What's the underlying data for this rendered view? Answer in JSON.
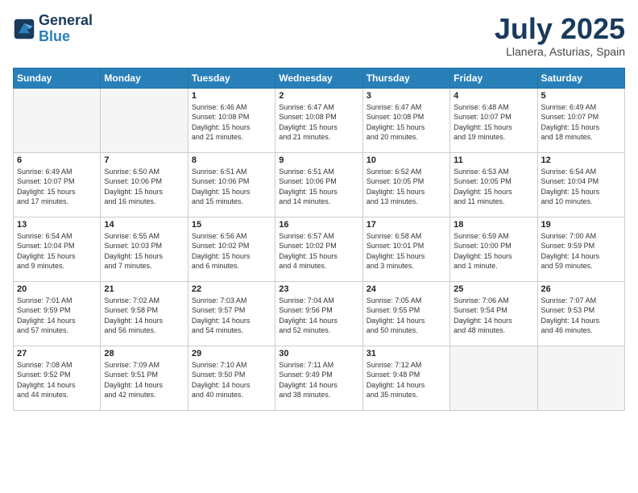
{
  "header": {
    "logo_line1": "General",
    "logo_line2": "Blue",
    "month_title": "July 2025",
    "location": "Llanera, Asturias, Spain"
  },
  "weekdays": [
    "Sunday",
    "Monday",
    "Tuesday",
    "Wednesday",
    "Thursday",
    "Friday",
    "Saturday"
  ],
  "weeks": [
    [
      {
        "day": "",
        "info": ""
      },
      {
        "day": "",
        "info": ""
      },
      {
        "day": "1",
        "info": "Sunrise: 6:46 AM\nSunset: 10:08 PM\nDaylight: 15 hours\nand 21 minutes."
      },
      {
        "day": "2",
        "info": "Sunrise: 6:47 AM\nSunset: 10:08 PM\nDaylight: 15 hours\nand 21 minutes."
      },
      {
        "day": "3",
        "info": "Sunrise: 6:47 AM\nSunset: 10:08 PM\nDaylight: 15 hours\nand 20 minutes."
      },
      {
        "day": "4",
        "info": "Sunrise: 6:48 AM\nSunset: 10:07 PM\nDaylight: 15 hours\nand 19 minutes."
      },
      {
        "day": "5",
        "info": "Sunrise: 6:49 AM\nSunset: 10:07 PM\nDaylight: 15 hours\nand 18 minutes."
      }
    ],
    [
      {
        "day": "6",
        "info": "Sunrise: 6:49 AM\nSunset: 10:07 PM\nDaylight: 15 hours\nand 17 minutes."
      },
      {
        "day": "7",
        "info": "Sunrise: 6:50 AM\nSunset: 10:06 PM\nDaylight: 15 hours\nand 16 minutes."
      },
      {
        "day": "8",
        "info": "Sunrise: 6:51 AM\nSunset: 10:06 PM\nDaylight: 15 hours\nand 15 minutes."
      },
      {
        "day": "9",
        "info": "Sunrise: 6:51 AM\nSunset: 10:06 PM\nDaylight: 15 hours\nand 14 minutes."
      },
      {
        "day": "10",
        "info": "Sunrise: 6:52 AM\nSunset: 10:05 PM\nDaylight: 15 hours\nand 13 minutes."
      },
      {
        "day": "11",
        "info": "Sunrise: 6:53 AM\nSunset: 10:05 PM\nDaylight: 15 hours\nand 11 minutes."
      },
      {
        "day": "12",
        "info": "Sunrise: 6:54 AM\nSunset: 10:04 PM\nDaylight: 15 hours\nand 10 minutes."
      }
    ],
    [
      {
        "day": "13",
        "info": "Sunrise: 6:54 AM\nSunset: 10:04 PM\nDaylight: 15 hours\nand 9 minutes."
      },
      {
        "day": "14",
        "info": "Sunrise: 6:55 AM\nSunset: 10:03 PM\nDaylight: 15 hours\nand 7 minutes."
      },
      {
        "day": "15",
        "info": "Sunrise: 6:56 AM\nSunset: 10:02 PM\nDaylight: 15 hours\nand 6 minutes."
      },
      {
        "day": "16",
        "info": "Sunrise: 6:57 AM\nSunset: 10:02 PM\nDaylight: 15 hours\nand 4 minutes."
      },
      {
        "day": "17",
        "info": "Sunrise: 6:58 AM\nSunset: 10:01 PM\nDaylight: 15 hours\nand 3 minutes."
      },
      {
        "day": "18",
        "info": "Sunrise: 6:59 AM\nSunset: 10:00 PM\nDaylight: 15 hours\nand 1 minute."
      },
      {
        "day": "19",
        "info": "Sunrise: 7:00 AM\nSunset: 9:59 PM\nDaylight: 14 hours\nand 59 minutes."
      }
    ],
    [
      {
        "day": "20",
        "info": "Sunrise: 7:01 AM\nSunset: 9:59 PM\nDaylight: 14 hours\nand 57 minutes."
      },
      {
        "day": "21",
        "info": "Sunrise: 7:02 AM\nSunset: 9:58 PM\nDaylight: 14 hours\nand 56 minutes."
      },
      {
        "day": "22",
        "info": "Sunrise: 7:03 AM\nSunset: 9:57 PM\nDaylight: 14 hours\nand 54 minutes."
      },
      {
        "day": "23",
        "info": "Sunrise: 7:04 AM\nSunset: 9:56 PM\nDaylight: 14 hours\nand 52 minutes."
      },
      {
        "day": "24",
        "info": "Sunrise: 7:05 AM\nSunset: 9:55 PM\nDaylight: 14 hours\nand 50 minutes."
      },
      {
        "day": "25",
        "info": "Sunrise: 7:06 AM\nSunset: 9:54 PM\nDaylight: 14 hours\nand 48 minutes."
      },
      {
        "day": "26",
        "info": "Sunrise: 7:07 AM\nSunset: 9:53 PM\nDaylight: 14 hours\nand 46 minutes."
      }
    ],
    [
      {
        "day": "27",
        "info": "Sunrise: 7:08 AM\nSunset: 9:52 PM\nDaylight: 14 hours\nand 44 minutes."
      },
      {
        "day": "28",
        "info": "Sunrise: 7:09 AM\nSunset: 9:51 PM\nDaylight: 14 hours\nand 42 minutes."
      },
      {
        "day": "29",
        "info": "Sunrise: 7:10 AM\nSunset: 9:50 PM\nDaylight: 14 hours\nand 40 minutes."
      },
      {
        "day": "30",
        "info": "Sunrise: 7:11 AM\nSunset: 9:49 PM\nDaylight: 14 hours\nand 38 minutes."
      },
      {
        "day": "31",
        "info": "Sunrise: 7:12 AM\nSunset: 9:48 PM\nDaylight: 14 hours\nand 35 minutes."
      },
      {
        "day": "",
        "info": ""
      },
      {
        "day": "",
        "info": ""
      }
    ]
  ]
}
